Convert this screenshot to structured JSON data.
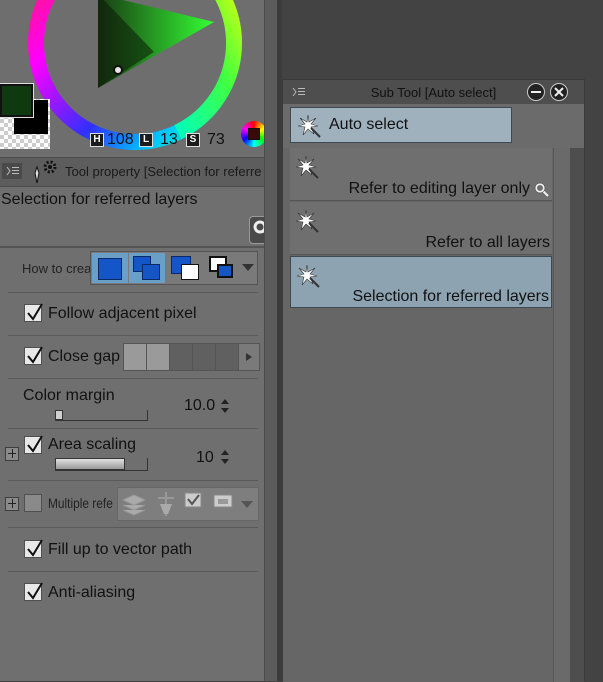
{
  "color_panel": {
    "h_label": "H",
    "h_value": "108",
    "s_label": "L",
    "s_value": "13",
    "v_label": "S",
    "v_value": "73",
    "main_color": "#0f3a10",
    "sub_color": "#000000"
  },
  "tool_property": {
    "title": "Tool property [Selection for referre",
    "tool_name": "Selection for referred layers",
    "how_to_create_label": "How to crea",
    "follow_adjacent_label": "Follow adjacent pixel",
    "close_gap_label": "Close gap",
    "color_margin_label": "Color margin",
    "color_margin_value": "10.0",
    "area_scaling_label": "Area scaling",
    "area_scaling_value": "10",
    "multiple_ref_label": "Multiple refe",
    "fill_vector_label": "Fill up to vector path",
    "anti_aliasing_label": "Anti-aliasing"
  },
  "sub_tool": {
    "title": "Sub Tool [Auto select]",
    "group_label": "Auto select",
    "items": [
      {
        "label": "Refer to editing layer only"
      },
      {
        "label": "Refer to all layers"
      },
      {
        "label": "Selection for referred layers"
      }
    ]
  }
}
